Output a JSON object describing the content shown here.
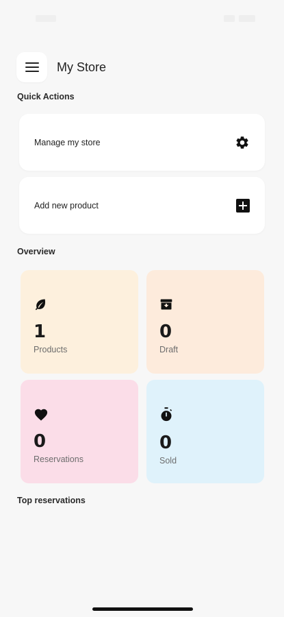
{
  "app": {
    "title": "My Store"
  },
  "quick_actions": {
    "heading": "Quick Actions",
    "items": [
      {
        "label": "Manage my store",
        "icon": "gear-icon"
      },
      {
        "label": "Add new product",
        "icon": "add-box-icon"
      }
    ]
  },
  "overview": {
    "heading": "Overview",
    "cards": [
      {
        "value": "1",
        "label": "Products",
        "icon": "leaf-icon",
        "color": "#fdf0dd"
      },
      {
        "value": "0",
        "label": "Draft",
        "icon": "archive-icon",
        "color": "#fdebdc"
      },
      {
        "value": "0",
        "label": "Reservations",
        "icon": "heart-icon",
        "color": "#fbdde8"
      },
      {
        "value": "0",
        "label": "Sold",
        "icon": "timer-icon",
        "color": "#dff2fb"
      }
    ]
  },
  "top_reservations": {
    "heading": "Top reservations"
  },
  "colors": {
    "background": "#f7f7f7",
    "card": "#ffffff",
    "text": "#1d1d1d"
  }
}
